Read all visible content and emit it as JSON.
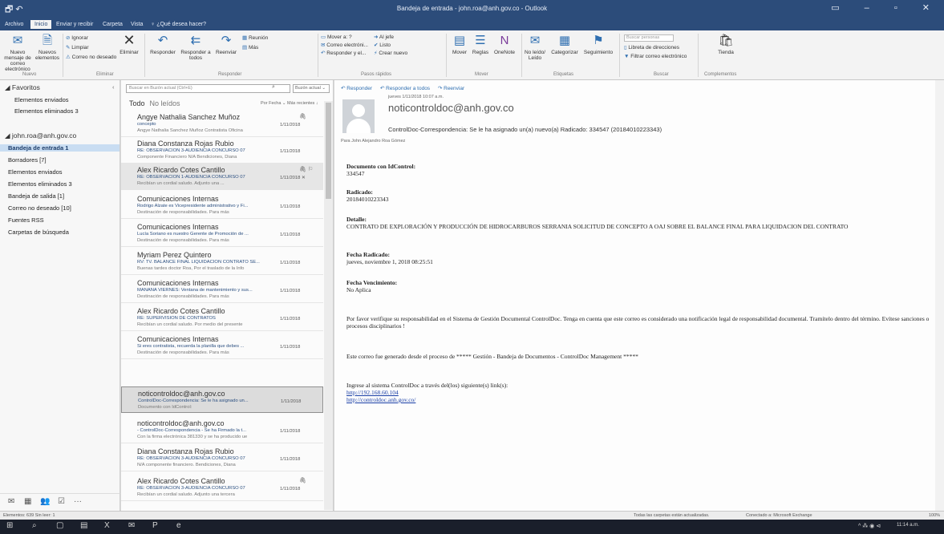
{
  "window": {
    "title": "Bandeja de entrada - john.roa@anh.gov.co - Outlook",
    "quick_access": "🗗 ↶",
    "controls": "▭ – ▫ ✕"
  },
  "tabs": [
    {
      "label": "Archivo"
    },
    {
      "label": "Inicio"
    },
    {
      "label": "Enviar y recibir"
    },
    {
      "label": "Carpeta"
    },
    {
      "label": "Vista"
    },
    {
      "label": "♀ ¿Qué desea hacer?"
    }
  ],
  "ribbon": {
    "new_email": "Nuevo mensaje de correo electrónico",
    "new_items": "Nuevos elementos",
    "group_new": "Nuevo",
    "ignore": "Ignorar",
    "clean": "Limpiar",
    "junk": "Correo no deseado",
    "delete": "Eliminar",
    "group_delete": "Eliminar",
    "reply": "Responder",
    "reply_all": "Responder a todos",
    "forward": "Reenviar",
    "meeting": "Reunión",
    "more": "Más",
    "group_respond": "Responder",
    "move_to": "Mover a: ?",
    "to_manager": "Al jefe",
    "team_email": "Correo electróni...",
    "done": "Listo",
    "reply_delete": "Responder y el...",
    "create_new": "Crear nuevo",
    "group_quicksteps": "Pasos rápidos",
    "move": "Mover",
    "rules": "Reglas",
    "onenote": "OneNote",
    "group_move": "Mover",
    "unread_read": "No leído/ Leído",
    "categorize": "Categorizar",
    "followup": "Seguimiento",
    "group_tags": "Etiquetas",
    "search_people": "Buscar personas",
    "address_book": "Libreta de direcciones",
    "filter_email": "Filtrar correo electrónico",
    "group_find": "Buscar",
    "store": "Tienda",
    "group_addins": "Complementos"
  },
  "folders": {
    "favorites_header": "Favoritos",
    "favorites": [
      "Elementos enviados",
      "Elementos eliminados  3"
    ],
    "account": "john.roa@anh.gov.co",
    "items": [
      "Bandeja de entrada  1",
      "Borradores [7]",
      "Elementos enviados",
      "Elementos eliminados  3",
      "Bandeja de salida [1]",
      "Correo no deseado [10]",
      "Fuentes RSS",
      "Carpetas de búsqueda"
    ]
  },
  "bottom_nav": [
    "✉",
    "▦",
    "👥",
    "☑",
    "···"
  ],
  "message_list": {
    "search_placeholder": "Buscar en Buzón actual (Ctrl+E)",
    "search_scope": "Buzón actual ⌄",
    "filter_all": "Todo",
    "filter_unread": "No leídos",
    "sort": "Por Fecha ⌄    Más recientes ↓",
    "messages": [
      {
        "from": "Angye Nathalia Sanchez Muñoz",
        "subject": "concepto",
        "preview": "Angye Nathalia Sanchez Muñoz  Contratista  Oficina",
        "date": "1/11/2018",
        "icon": "🖇"
      },
      {
        "from": "Diana Constanza Rojas Rubio",
        "subject": "RE: OBSERVACION 3-AUDIENCIA CONCURSO 07",
        "preview": "Componente Financiero N/A  Bendiciones,  Diana",
        "date": "1/11/2018",
        "icon": ""
      },
      {
        "from": "Alex Ricardo Cotes Cantillo",
        "subject": "RE: OBSERVACION 1-AUDIENCIA CONCURSO 07",
        "preview": "Recibían un cordial saludo.  Adjunto una ...",
        "date": "1/11/2018 ✕",
        "icon": "🖇 ⚐"
      },
      {
        "from": "Comunicaciones Internas",
        "subject": "Rodrigo Alzate es Vicepresidente administrativo y Fi...",
        "preview": "Destinación de responsabilidades.  Para más",
        "date": "1/11/2018",
        "icon": ""
      },
      {
        "from": "Comunicaciones Internas",
        "subject": "Lucía Soriano es nuestro Gerente de Promoción de ...",
        "preview": "Destinación de responsabilidades.  Para más",
        "date": "1/11/2018",
        "icon": ""
      },
      {
        "from": "Myriam Perez Quintero",
        "subject": "RV: TV. BALANCE FINAL LIQUIDACION CONTRATO SE...",
        "preview": "Buenas tardes doctor Roa,  Por el traslado de la Info",
        "date": "1/11/2018",
        "icon": ""
      },
      {
        "from": "Comunicaciones Internas",
        "subject": "MAÑANA VIERNES: Ventana de mantenimiento y sus...",
        "preview": "Destinación de responsabilidades.  Para más",
        "date": "1/11/2018",
        "icon": ""
      },
      {
        "from": "Alex Ricardo Cotes Cantillo",
        "subject": "RE: SUPERVISIÓN DE CONTRATOS",
        "preview": "Recibían un cordial saludo.  Por medio del presente",
        "date": "1/11/2018",
        "icon": ""
      },
      {
        "from": "Comunicaciones Internas",
        "subject": "Si eres contratista, recuerda la planilla que debes ...",
        "preview": "Destinación de responsabilidades.  Para más",
        "date": "1/11/2018",
        "icon": ""
      },
      {
        "from": "noticontroldoc@anh.gov.co",
        "subject": "ControlDoc-Correspondencia: Se le ha asignado un...",
        "preview": "Documento con IdControl:",
        "date": "1/11/2018",
        "icon": ""
      },
      {
        "from": "noticontroldoc@anh.gov.co",
        "subject": "- ControlDoc-Correspondencia - Se ha Firmado la t...",
        "preview": "Con la firma electrónica 381330 y se ha producido ue",
        "date": "1/11/2018",
        "icon": ""
      },
      {
        "from": "Diana Constanza Rojas Rubio",
        "subject": "RE: OBSERVACION 3-AUDIENCIA CONCURSO 07",
        "preview": "N/A componente financiero.  Bendiciones,  Diana",
        "date": "1/11/2018",
        "icon": ""
      },
      {
        "from": "Alex Ricardo Cotes Cantillo",
        "subject": "RE: OBSERVACION 3-AUDIENCIA CONCURSO 07",
        "preview": "Recibían un cordial saludo.  Adjunto una tercera",
        "date": "1/11/2018",
        "icon": "🖇"
      }
    ]
  },
  "reading_pane": {
    "actions": [
      "↶ Responder",
      "↶ Responder a todos",
      "↷ Reenviar"
    ],
    "date": "jueves 1/11/2018 10:07 a.m.",
    "from": "noticontroldoc@anh.gov.co",
    "subject": "ControlDoc-Correspondencia: Se le ha asignado un(a) nuevo(a) Radicado: 334547 (20184010223343)",
    "to": "Para   John Alejandro Roa Gómez",
    "body": {
      "idcontrol_label": "Documento con IdControl:",
      "idcontrol_value": "334547",
      "radicado_label": "Radicado:",
      "radicado_value": "20184010223343",
      "detalle_label": "Detalle:",
      "detalle_value": "CONTRATO DE EXPLORACIÓN Y PRODUCCIÓN DE HIDROCARBUROS SERRANIA SOLICITUD DE CONCEPTO A OAJ SOBRE EL BALANCE FINAL PARA LIQUIDACION DEL CONTRATO",
      "fecha_label": "Fecha Radicado:",
      "fecha_value": "jueves, noviembre 1, 2018 08:25:51",
      "venc_label": "Fecha Vencimiento:",
      "venc_value": "No Aplica",
      "notice": "Por favor verifique su responsabilidad en el Sistema de Gestión Documental ControlDoc. Tenga en cuenta que este correo es considerado una notificación legal de responsabilidad documental. Tramítelo dentro del término. Evítese sanciones o procesos disciplinarios !",
      "generated": "Este correo fue generado desde el proceso de ***** Gestión - Bandeja de Documentos - ControlDoc Management *****",
      "access": "Ingrese al sistema ControlDoc a través del(los) siguiente(s) link(s):",
      "link1": "http://192.168.60.104",
      "link2": "http://controldoc.anh.gov.co/"
    }
  },
  "status_bar": {
    "left": "Elementos: 639    Sin leer: 1",
    "sync": "Todas las carpetas están actualizadas.",
    "connection": "Conectado a: Microsoft Exchange",
    "zoom": "100%"
  },
  "taskbar": {
    "icons": [
      "⊞",
      "⌕",
      "▢",
      "▤",
      "X",
      "✉",
      "P",
      "e"
    ],
    "tray": "^ ⁂ ◉ ⊲",
    "time": "11:14 a.m."
  }
}
